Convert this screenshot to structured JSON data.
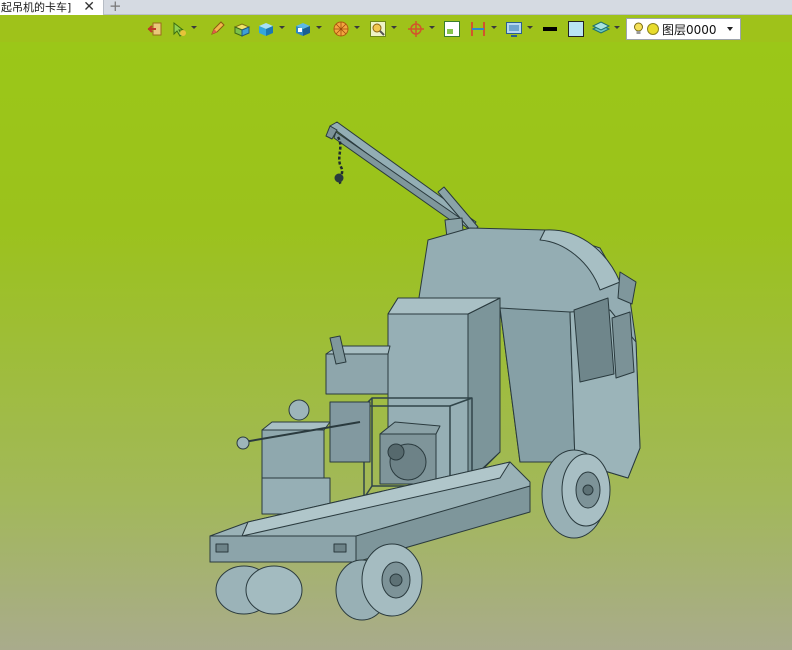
{
  "tab": {
    "title": "起吊机的卡车]",
    "close_glyph": "✕",
    "new_tab_glyph": "+"
  },
  "toolbar": {
    "buttons": [
      {
        "name": "exit-icon"
      },
      {
        "name": "pointer-icon",
        "has_dropdown": true
      },
      {
        "name": "pencil-icon"
      },
      {
        "name": "shaded-solid-icon"
      },
      {
        "name": "solid-box-icon",
        "has_dropdown": true
      },
      {
        "name": "view-cube-icon",
        "has_dropdown": true
      },
      {
        "name": "render-sphere-icon",
        "has_dropdown": true
      },
      {
        "name": "zoom-fit-icon",
        "has_dropdown": true
      },
      {
        "name": "crosshair-icon",
        "has_dropdown": true
      },
      {
        "name": "frame-icon"
      },
      {
        "name": "section-icon",
        "has_dropdown": true
      },
      {
        "name": "display-icon",
        "has_dropdown": true
      },
      {
        "name": "line-color-icon"
      },
      {
        "name": "fill-color-icon"
      },
      {
        "name": "layers-icon",
        "has_dropdown": true
      }
    ],
    "layer": {
      "value": "图层0000",
      "bulb_color": "#f5e15a",
      "dot_color": "#e8dc2c"
    }
  },
  "viewport": {
    "background_top": "#9bc718",
    "background_bottom": "#a9ab8c",
    "model_color": "#8fa8ae"
  }
}
